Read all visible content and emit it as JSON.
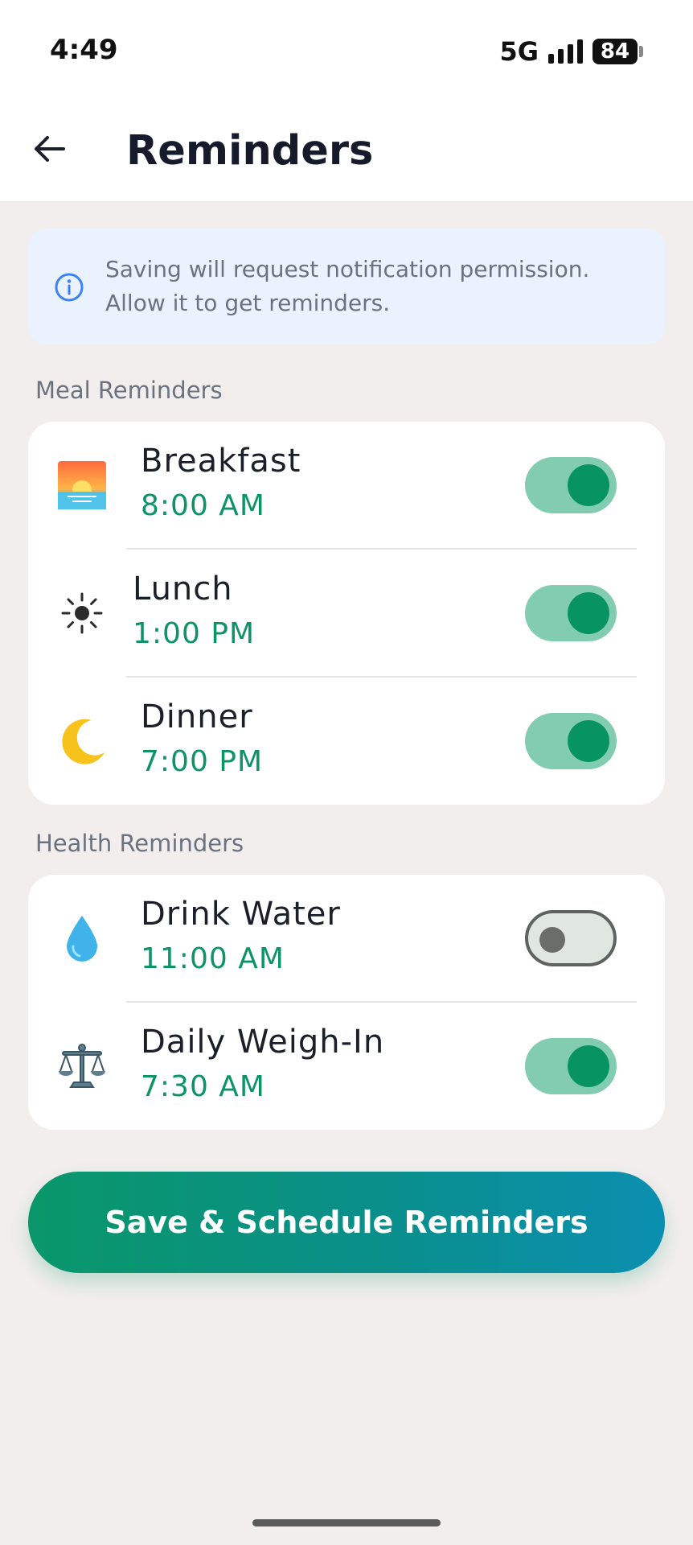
{
  "status_bar": {
    "time": "4:49",
    "network": "5G",
    "battery": "84"
  },
  "header": {
    "title": "Reminders"
  },
  "info_banner": {
    "line1": "Saving will request notification permission.",
    "line2": "Allow it to get reminders."
  },
  "meal_section": {
    "label": "Meal Reminders",
    "items": [
      {
        "name": "Breakfast",
        "time": "8:00 AM",
        "icon": "sunrise-icon",
        "enabled": true
      },
      {
        "name": "Lunch",
        "time": "1:00 PM",
        "icon": "sun-icon",
        "enabled": true
      },
      {
        "name": "Dinner",
        "time": "7:00 PM",
        "icon": "crescent-moon-icon",
        "enabled": true
      }
    ]
  },
  "health_section": {
    "label": "Health Reminders",
    "items": [
      {
        "name": "Drink Water",
        "time": "11:00 AM",
        "icon": "droplet-icon",
        "enabled": false
      },
      {
        "name": "Daily Weigh-In",
        "time": "7:30 AM",
        "icon": "balance-scale-icon",
        "enabled": true
      }
    ]
  },
  "save_button": {
    "label": "Save & Schedule Reminders"
  },
  "colors": {
    "accent": "#089462",
    "time_text": "#0d9466",
    "toggle_on_track": "#82cdb2",
    "info_bg": "#eaf3fd",
    "page_bg": "#f1eeed"
  }
}
